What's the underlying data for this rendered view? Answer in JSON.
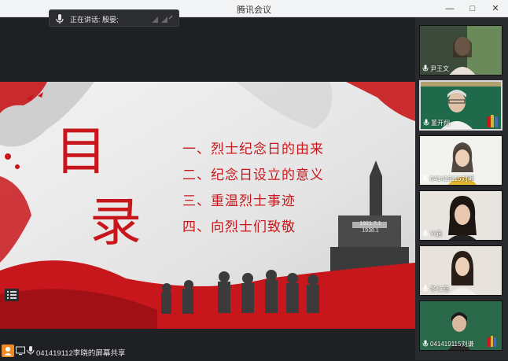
{
  "window": {
    "title": "腾讯会议"
  },
  "window_controls": {
    "minimize": "—",
    "maximize": "□",
    "close": "✕"
  },
  "speaker": {
    "text": "正在讲话: 殷晏;"
  },
  "slide": {
    "title_chars": [
      "目",
      "录"
    ],
    "items": [
      "一、烈士纪念日的由来",
      "二、纪念日设立的意义",
      "三、重温烈士事迹",
      "四、向烈士们致敬"
    ],
    "monument_text": [
      "1921.7.1",
      "1938.1"
    ]
  },
  "bottom": {
    "share_label": "041419112李晓的屏幕共享"
  },
  "participants": [
    {
      "name": "尹王文",
      "active": false
    },
    {
      "name": "董开翔",
      "active": true
    },
    {
      "name": "041419116刘玥",
      "active": false
    },
    {
      "name": "Yi涵",
      "active": false
    },
    {
      "name": "冬仁皓",
      "active": false
    },
    {
      "name": "041419115刘谦",
      "active": false
    }
  ],
  "colors": {
    "accent_red": "#c8171c",
    "active_tile_border": "#d8d8d8",
    "orange_icon": "#f08a24"
  }
}
